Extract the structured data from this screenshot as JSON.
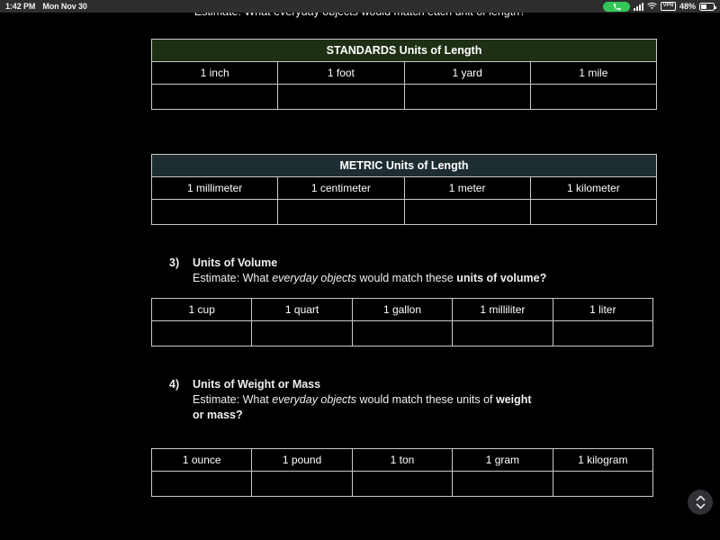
{
  "status_bar": {
    "time": "1:42 PM",
    "date": "Mon Nov 30",
    "call_icon": "phone-handset-icon",
    "signal_icon": "cellular-signal-icon",
    "wifi_icon": "wifi-icon",
    "vpn_label": "VPN",
    "battery_percent": "48%",
    "battery_icon": "battery-icon",
    "accent_green": "#33c759",
    "bar_background": "#2e2e2e"
  },
  "document": {
    "top_clipped_line": "Estimate: What everyday objects would match each unit of length?",
    "tables": [
      {
        "id": "standards-length",
        "banner": "STANDARDS Units of Length",
        "banner_color": "#1e2f14",
        "units": [
          "1 inch",
          "1 foot",
          "1 yard",
          "1 mile"
        ],
        "answers": [
          "",
          "",
          "",
          ""
        ]
      },
      {
        "id": "metric-length",
        "banner": "METRIC Units of Length",
        "banner_color": "#1e2d31",
        "units": [
          "1 millimeter",
          "1 centimeter",
          "1 meter",
          "1 kilometer"
        ],
        "answers": [
          "",
          "",
          "",
          ""
        ]
      },
      {
        "id": "volume",
        "banner": null,
        "units": [
          "1 cup",
          "1 quart",
          "1 gallon",
          "1 milliliter",
          "1 liter"
        ],
        "answers": [
          "",
          "",
          "",
          "",
          ""
        ]
      },
      {
        "id": "weight-mass",
        "banner": null,
        "units": [
          "1 ounce",
          "1 pound",
          "1 ton",
          "1 gram",
          "1 kilogram"
        ],
        "answers": [
          "",
          "",
          "",
          "",
          ""
        ]
      }
    ],
    "sections": [
      {
        "number": "3)",
        "title": "Units of Volume",
        "prompt_plain_1": "Estimate: What ",
        "prompt_italic": "everyday objects",
        "prompt_plain_2": " would match these ",
        "prompt_bold": "units of volume?"
      },
      {
        "number": "4)",
        "title": "Units of Weight or Mass",
        "prompt_plain_1": "Estimate: What ",
        "prompt_italic": "everyday objects",
        "prompt_plain_2": " would match these units of ",
        "prompt_bold": "weight or mass?"
      }
    ]
  },
  "controls": {
    "scroll_fab": {
      "name": "scroll-up-down-button",
      "up_icon": "chevron-up-icon",
      "down_icon": "chevron-down-icon"
    }
  }
}
